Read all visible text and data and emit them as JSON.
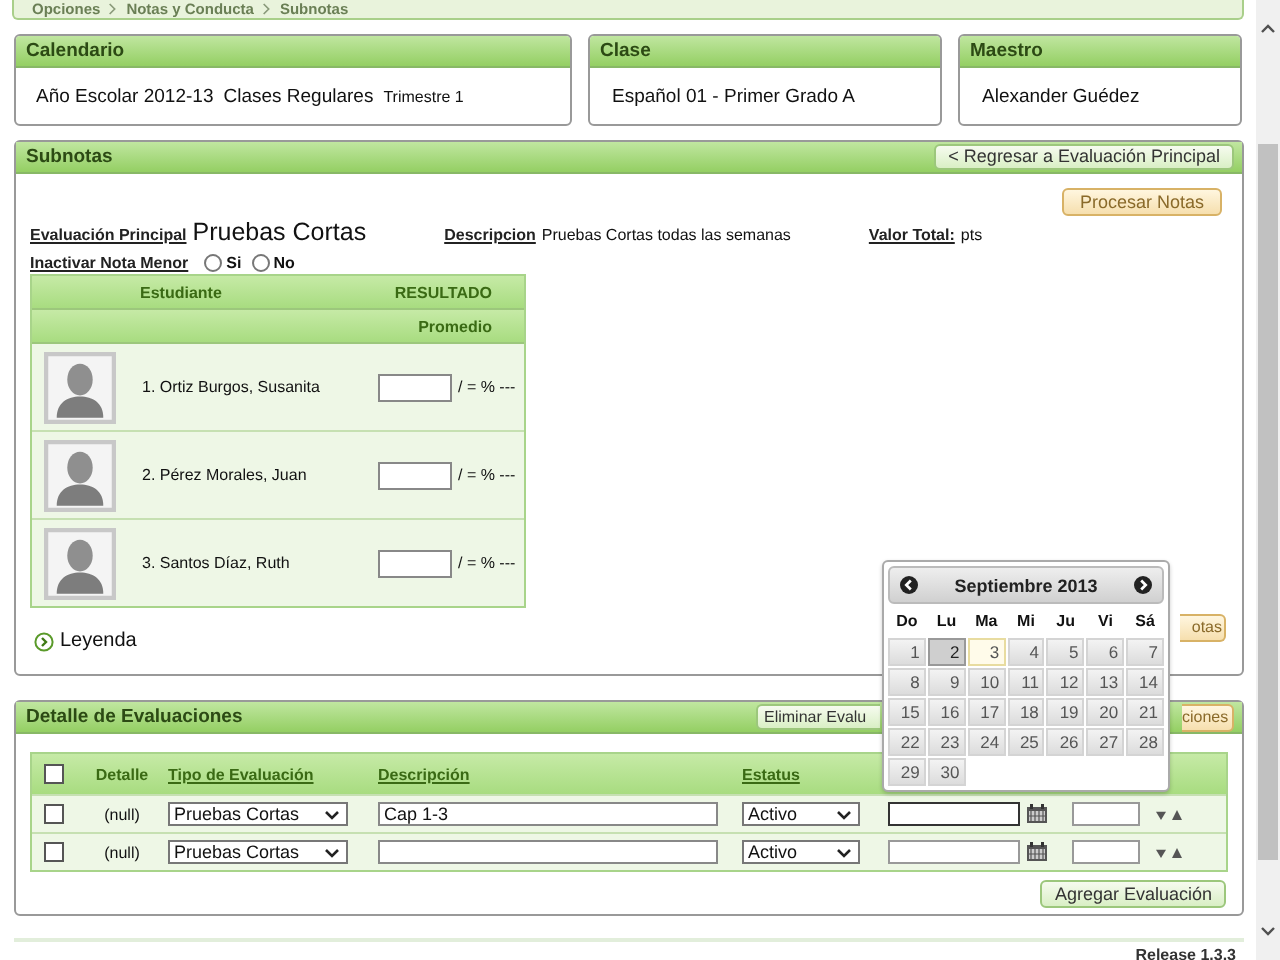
{
  "breadcrumb": [
    "Opciones",
    "Notas y Conducta",
    "Subnotas"
  ],
  "cards": [
    {
      "title": "Calendario",
      "parts": [
        {
          "text": "Año Escolar 2012-13",
          "kind": "normal"
        },
        {
          "text": "Clases Regulares",
          "kind": "normal"
        },
        {
          "text": "Trimestre 1",
          "kind": "small"
        }
      ]
    },
    {
      "title": "Clase",
      "parts": [
        {
          "text": "Español 01 -  Primer Grado  A",
          "kind": "normal"
        }
      ]
    },
    {
      "title": "Maestro",
      "parts": [
        {
          "text": "Alexander Guédez",
          "kind": "normal"
        }
      ]
    }
  ],
  "subnotas": {
    "title": "Subnotas",
    "back_button": "< Regresar a Evaluación Principal",
    "process_button": "Procesar Notas",
    "main_eval": {
      "label": "Evaluación Principal",
      "value": "Pruebas Cortas"
    },
    "description": {
      "label": "Descripcion",
      "value": "Pruebas Cortas todas las semanas"
    },
    "total": {
      "label": "Valor Total:",
      "value": "pts"
    },
    "inactivate": {
      "label": "Inactivar Nota Menor",
      "options": [
        {
          "label": "Si",
          "selected": false
        },
        {
          "label": "No",
          "selected": false
        }
      ]
    },
    "columns": [
      "Estudiante",
      "RESULTADO"
    ],
    "subheader": "Promedio",
    "students": [
      {
        "name": "1. Ortiz Burgos, Susanita",
        "suffix": "/ = % ---"
      },
      {
        "name": "2. Pérez Morales, Juan",
        "suffix": "/ = % ---"
      },
      {
        "name": "3. Santos Díaz, Ruth",
        "suffix": "/ = % ---"
      }
    ],
    "save_button": "otas",
    "legend": "Leyenda"
  },
  "detail": {
    "title": "Detalle de Evaluaciones",
    "delete_button": "Eliminar Evalu",
    "other_button": "ciones",
    "header_checked": false,
    "columns": [
      "Detalle",
      "Tipo de Evaluación",
      "Descripción",
      "Estatus"
    ],
    "rows": [
      {
        "checked": false,
        "detail": "(null)",
        "type": "Pruebas Cortas",
        "description": "Cap 1-3",
        "status": "Activo"
      },
      {
        "checked": false,
        "detail": "(null)",
        "type": "Pruebas Cortas",
        "status": "Activo"
      }
    ],
    "add_button": "Agregar Evaluación"
  },
  "calendar": {
    "title": "Septiembre 2013",
    "weekdays": [
      "Do",
      "Lu",
      "Ma",
      "Mi",
      "Ju",
      "Vi",
      "Sá"
    ],
    "days": [
      {
        "label": "1",
        "selected": false,
        "today": false
      },
      {
        "label": "2",
        "selected": true,
        "today": false
      },
      {
        "label": "3",
        "selected": false,
        "today": true
      },
      {
        "label": "4",
        "selected": false,
        "today": false
      },
      {
        "label": "5",
        "selected": false,
        "today": false
      },
      {
        "label": "6",
        "selected": false,
        "today": false
      },
      {
        "label": "7",
        "selected": false,
        "today": false
      },
      {
        "label": "8",
        "selected": false,
        "today": false
      },
      {
        "label": "9",
        "selected": false,
        "today": false
      },
      {
        "label": "10",
        "selected": false,
        "today": false
      },
      {
        "label": "11",
        "selected": false,
        "today": false
      },
      {
        "label": "12",
        "selected": false,
        "today": false
      },
      {
        "label": "13",
        "selected": false,
        "today": false
      },
      {
        "label": "14",
        "selected": false,
        "today": false
      },
      {
        "label": "15",
        "selected": false,
        "today": false
      },
      {
        "label": "16",
        "selected": false,
        "today": false
      },
      {
        "label": "17",
        "selected": false,
        "today": false
      },
      {
        "label": "18",
        "selected": false,
        "today": false
      },
      {
        "label": "19",
        "selected": false,
        "today": false
      },
      {
        "label": "20",
        "selected": false,
        "today": false
      },
      {
        "label": "21",
        "selected": false,
        "today": false
      },
      {
        "label": "22",
        "selected": false,
        "today": false
      },
      {
        "label": "23",
        "selected": false,
        "today": false
      },
      {
        "label": "24",
        "selected": false,
        "today": false
      },
      {
        "label": "25",
        "selected": false,
        "today": false
      },
      {
        "label": "26",
        "selected": false,
        "today": false
      },
      {
        "label": "27",
        "selected": false,
        "today": false
      },
      {
        "label": "28",
        "selected": false,
        "today": false
      },
      {
        "label": "29",
        "selected": false,
        "today": false
      },
      {
        "label": "30",
        "selected": false,
        "today": false
      }
    ]
  },
  "footer": "Release 1.3.3"
}
